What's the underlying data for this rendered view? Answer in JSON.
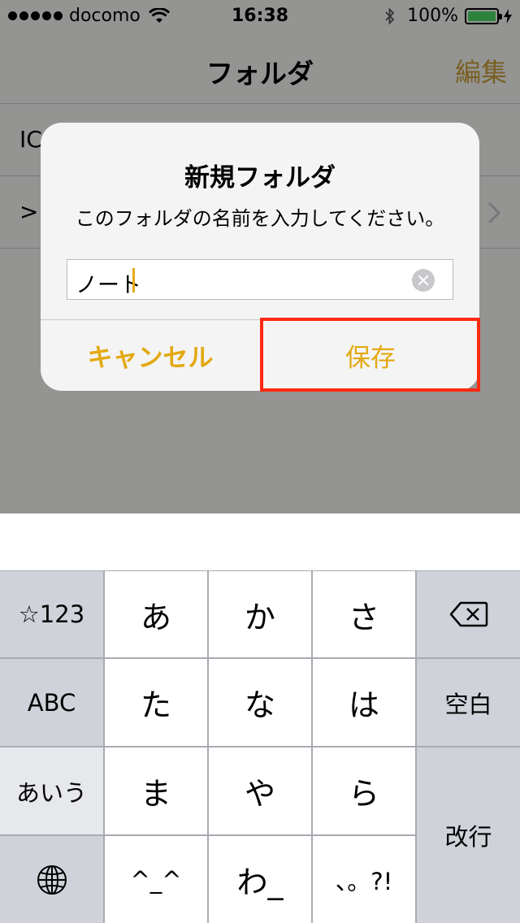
{
  "status_bar": {
    "carrier": "docomo",
    "time": "16:38",
    "battery_percent": "100%",
    "battery_level": 1.0,
    "battery_color": "#4cd964"
  },
  "nav": {
    "title": "フォルダ",
    "edit": "編集"
  },
  "folder_rows": [
    "IC",
    ">"
  ],
  "alert": {
    "title": "新規フォルダ",
    "message": "このフォルダの名前を入力してください。",
    "field_value": "ノート",
    "cancel": "キャンセル",
    "save": "保存",
    "accent_color": "#e3a912"
  },
  "highlight_color": "#ff2a12",
  "keyboard": {
    "keys": {
      "numbers": "☆123",
      "abc": "ABC",
      "aiu": "あいう",
      "globe": "globe-icon",
      "a": "あ",
      "ka": "か",
      "sa": "さ",
      "ta": "た",
      "na": "な",
      "ha": "は",
      "ma": "ま",
      "ya": "や",
      "ra": "ら",
      "kaomoji": "^_^",
      "wa": "わ_",
      "punct": "、。?!",
      "backspace": "delete-icon",
      "space": "空白",
      "return": "改行"
    }
  }
}
